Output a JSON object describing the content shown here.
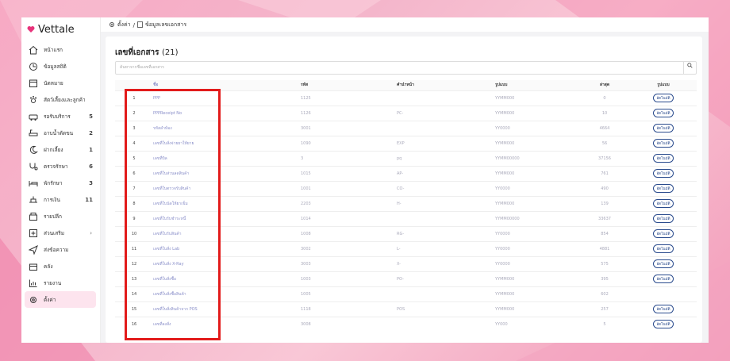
{
  "brand": {
    "name": "Vettale",
    "accent": "#e8337b"
  },
  "breadcrumb": {
    "root": "ตั้งค่า",
    "sep": "/",
    "current": "ข้อมูลเลขเอกสาร"
  },
  "sidebar": {
    "items": [
      {
        "label": "หน้าแรก",
        "icon": "home-icon",
        "count": ""
      },
      {
        "label": "ข้อมูลสถิติ",
        "icon": "stats-icon",
        "count": ""
      },
      {
        "label": "นัดหมาย",
        "icon": "calendar-icon",
        "count": ""
      },
      {
        "label": "สัตว์เลี้ยงและลูกค้า",
        "icon": "pet-icon",
        "count": ""
      },
      {
        "label": "รอรับบริการ",
        "icon": "car-icon",
        "count": "5"
      },
      {
        "label": "อาบน้ำตัดขน",
        "icon": "bath-icon",
        "count": "2"
      },
      {
        "label": "ฝากเลี้ยง",
        "icon": "moon-icon",
        "count": "1"
      },
      {
        "label": "ตรวจรักษา",
        "icon": "stethoscope-icon",
        "count": "6"
      },
      {
        "label": "พักรักษา",
        "icon": "bed-icon",
        "count": "3"
      },
      {
        "label": "การเงิน",
        "icon": "money-icon",
        "count": "11"
      },
      {
        "label": "รายปลีก",
        "icon": "register-icon",
        "count": ""
      },
      {
        "label": "ส่วนเสริม",
        "icon": "plus-icon",
        "count": ""
      },
      {
        "label": "ส่งข้อความ",
        "icon": "send-icon",
        "count": ""
      },
      {
        "label": "คลัง",
        "icon": "box-icon",
        "count": ""
      },
      {
        "label": "รายงาน",
        "icon": "report-icon",
        "count": ""
      },
      {
        "label": "ตั้งค่า",
        "icon": "gear-icon",
        "count": ""
      }
    ],
    "chevron": "›"
  },
  "page": {
    "title": "เลขที่เอกสาร",
    "count": "(21)",
    "search_placeholder": "ค้นหาจากชื่อเลขที่เอกสาร"
  },
  "table": {
    "headers": [
      "",
      "ชื่อ",
      "รหัส",
      "คำนำหน้า",
      "รูปแบบ",
      "ล่าสุด",
      "รูปแบบ"
    ],
    "action_label": "อัตโนมัติ",
    "rows": [
      {
        "idx": "1",
        "name": "PPP",
        "code": "1125",
        "prefix": "",
        "format": "YYMM000",
        "last": "0",
        "action": true
      },
      {
        "idx": "2",
        "name": "PPPReceipt No",
        "code": "1126",
        "prefix": "PC-",
        "format": "YYMM000",
        "last": "10",
        "action": true
      },
      {
        "idx": "3",
        "name": "รหัสลำห้อง",
        "code": "3001",
        "prefix": "",
        "format": "YY0000",
        "last": "4664",
        "action": true
      },
      {
        "idx": "4",
        "name": "เลขที่ใบสั่งจ่ายยาให้ยาย",
        "code": "1090",
        "prefix": "EXP",
        "format": "YYMM000",
        "last": "56",
        "action": true
      },
      {
        "idx": "5",
        "name": "เลขที่บิล",
        "code": "3",
        "prefix": "pq",
        "format": "YYMM00000",
        "last": "37156",
        "action": true
      },
      {
        "idx": "6",
        "name": "เลขที่ใบส่วนลดสินค้า",
        "code": "1015",
        "prefix": "AP-",
        "format": "YYMM000",
        "last": "761",
        "action": true
      },
      {
        "idx": "7",
        "name": "เลขที่ใบตรวจรับสินค้า",
        "code": "1001",
        "prefix": "CO-",
        "format": "YY0000",
        "last": "490",
        "action": true
      },
      {
        "idx": "8",
        "name": "เลขที่ใบนัดให้ยาเข็ม",
        "code": "2203",
        "prefix": "H-",
        "format": "YYMM000",
        "last": "139",
        "action": true
      },
      {
        "idx": "9",
        "name": "เลขที่ใบรับชำระหนี้",
        "code": "1014",
        "prefix": "",
        "format": "YYMM00000",
        "last": "33637",
        "action": true
      },
      {
        "idx": "10",
        "name": "เลขที่ใบรับสินค้า",
        "code": "1008",
        "prefix": "RG-",
        "format": "YY0000",
        "last": "854",
        "action": true
      },
      {
        "idx": "11",
        "name": "เลขที่ใบสั่ง Lab",
        "code": "3002",
        "prefix": "L-",
        "format": "YY0000",
        "last": "4881",
        "action": true
      },
      {
        "idx": "12",
        "name": "เลขที่ใบสั่ง X-Ray",
        "code": "3003",
        "prefix": "X-",
        "format": "YY0000",
        "last": "575",
        "action": true
      },
      {
        "idx": "13",
        "name": "เลขที่ใบสั่งซื้อ",
        "code": "1003",
        "prefix": "PO-",
        "format": "YYMM000",
        "last": "395",
        "action": true
      },
      {
        "idx": "14",
        "name": "เลขที่ใบสั่งซื้อสินค้า",
        "code": "1005",
        "prefix": "",
        "format": "YYMM000",
        "last": "602",
        "action": false
      },
      {
        "idx": "15",
        "name": "เลขที่ใบสั่งสินค้าจาก POS",
        "code": "1118",
        "prefix": "POS",
        "format": "YYMM000",
        "last": "257",
        "action": true
      },
      {
        "idx": "16",
        "name": "เลขที่ลงสั่ง",
        "code": "3008",
        "prefix": "",
        "format": "YY000",
        "last": "5",
        "action": true
      }
    ]
  },
  "highlight_color": "#e21b1b"
}
